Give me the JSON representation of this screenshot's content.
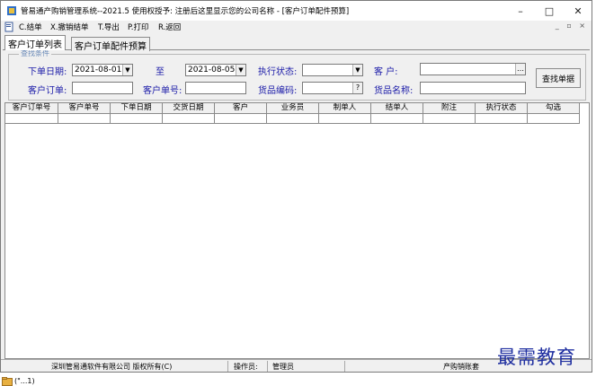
{
  "window": {
    "title": "管易通产购销管理系统--2021.5 使用权授予: 注册后这里显示您的公司名称 - [客户订单配件预算]",
    "controls": {
      "minimize": "–",
      "maximize": "□",
      "close": "✕"
    }
  },
  "menu": {
    "items": [
      "C.结单",
      "X.撤销结单",
      "T.导出",
      "P.打印",
      "R.返回"
    ],
    "mdi_controls": "_ ▫ ×"
  },
  "tabs": [
    {
      "label": "客户订单列表",
      "active": true
    },
    {
      "label": "客户订单配件预算",
      "active": false
    }
  ],
  "search": {
    "legend": "查找条件",
    "order_date_label": "下单日期:",
    "date_from": "2021-08-01",
    "to_label": "至",
    "date_to": "2021-08-05",
    "status_label": "执行状态:",
    "status_value": "",
    "customer_label": "客  户:",
    "customer_value": "",
    "customer_order_label": "客户订单:",
    "customer_order_value": "",
    "customer_no_label": "客户单号:",
    "customer_no_value": "",
    "item_code_label": "货品编码:",
    "item_code_value": "",
    "item_name_label": "货品名称:",
    "item_name_value": "",
    "search_button": "查找单据",
    "dropdown_glyph": "▼",
    "lookup_glyph": "?",
    "ellipsis_glyph": "…"
  },
  "grid": {
    "columns": [
      "客户订单号",
      "客户单号",
      "下单日期",
      "交货日期",
      "客户",
      "业务员",
      "制单人",
      "结单人",
      "附注",
      "执行状态",
      "勾选"
    ],
    "rows": []
  },
  "status_bar": {
    "company": "深圳管易通软件有限公司  版权所有(C)",
    "operator_label": "操作员:",
    "operator_value": "管理员",
    "suite": "产购销账套"
  },
  "watermark": "最需教育",
  "taskbar": {
    "label": "(\"...1)"
  },
  "colors": {
    "label_blue": "#1a1aa8",
    "legend_blue": "#6a8ab8",
    "watermark_blue": "#1f2fa0"
  }
}
